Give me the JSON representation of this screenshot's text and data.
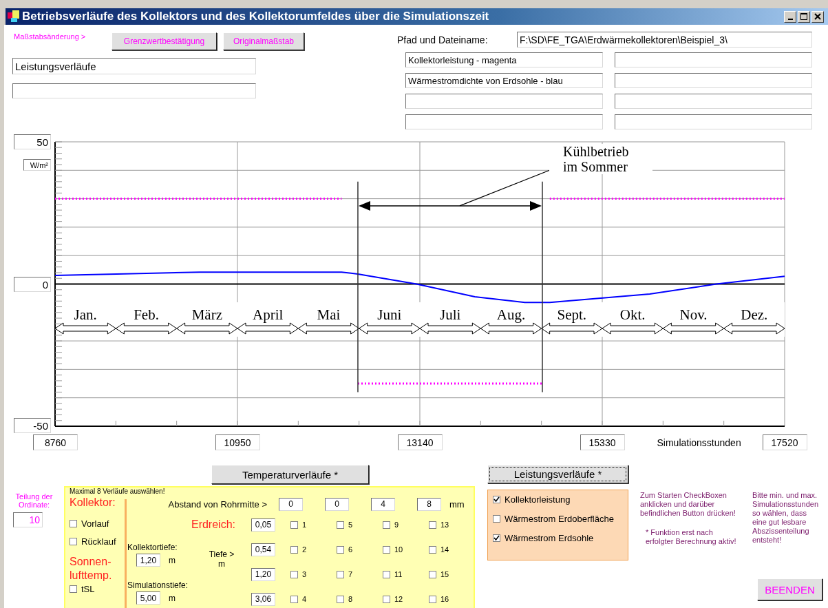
{
  "window": {
    "title": "Betriebsverläufe des Kollektors und des Kollektorumfeldes über die Simulationszeit"
  },
  "scale": {
    "label": "Maßstabsänderung >",
    "buttons": [
      "Grenzwertbestätigung",
      "Originalmaßstab"
    ]
  },
  "heading_field": {
    "value": "Leistungsverläufe"
  },
  "path": {
    "label": "Pfad und Dateiname:",
    "value": "F:\\SD\\FE_TGA\\Erdwärmekollektoren\\Beispiel_3\\"
  },
  "legend_fields": [
    "Kollektorleistung - magenta",
    "Wärmestromdichte von Erdsohle - blau"
  ],
  "y_unit": "W/m²",
  "chart_data": {
    "type": "line",
    "x": [
      8760,
      9500,
      10500,
      11500,
      12200,
      12396,
      13100,
      13800,
      14400,
      14611,
      14700,
      15900,
      16700,
      17520
    ],
    "xlim": [
      8760,
      17520
    ],
    "ylim": [
      -50,
      50
    ],
    "xticks": [
      8760,
      10950,
      13140,
      15330,
      17520
    ],
    "yticks": [
      -50,
      0,
      50
    ],
    "series": [
      {
        "color": "#ff00ff",
        "line_style": "dotted",
        "values": [
          30,
          30,
          30,
          30,
          30,
          -35,
          -35,
          -35,
          -35,
          -35,
          30,
          30,
          30,
          30
        ]
      },
      {
        "color": "#0000ff",
        "line_style": "solid",
        "values": [
          3,
          3.5,
          4.2,
          4.2,
          4.2,
          3.5,
          0,
          -4.5,
          -6.5,
          -6.5,
          -6.5,
          -3.5,
          0,
          2.7
        ]
      }
    ],
    "grid": true,
    "ref_lines": [
      {
        "axis": "x",
        "value": 12396
      },
      {
        "axis": "x",
        "value": 14611
      }
    ],
    "annotations": [
      "Kühlbetrieb im Sommer"
    ]
  },
  "months": [
    "Jan.",
    "Feb.",
    "März",
    "April",
    "Mai",
    "Juni",
    "Juli",
    "Aug.",
    "Sept.",
    "Okt.",
    "Nov.",
    "Dez."
  ],
  "x_label": "Simulationsstunden",
  "temperature_button": "Temperaturverläufe *",
  "ordinate": {
    "label": "Teilung der Ordinate:",
    "value": "10"
  },
  "temperature_panel": {
    "title": "Maximal 8 Verläufe auswählen!",
    "collector_heading": "Kollektor:",
    "collector_options": [
      {
        "label": "Vorlauf",
        "checked": false
      },
      {
        "label": "Rücklauf",
        "checked": false
      }
    ],
    "sun_heading": "Sonnen-lufttemp.",
    "sun_options": [
      {
        "label": "tSL",
        "checked": false
      }
    ],
    "distance_label": "Abstand von Rohrmitte >",
    "distances": [
      "0",
      "0",
      "4",
      "8"
    ],
    "distance_unit": "mm",
    "soil_heading": "Erdreich:",
    "depth_label": "Tiefe >",
    "depth_unit": "m",
    "depths": [
      {
        "value": "0,05",
        "sensors": [
          {
            "label": "1",
            "checked": false
          },
          {
            "label": "5",
            "checked": false
          },
          {
            "label": "9",
            "checked": false
          },
          {
            "label": "13",
            "checked": false
          }
        ]
      },
      {
        "value": "0,54",
        "sensors": [
          {
            "label": "2",
            "checked": false
          },
          {
            "label": "6",
            "checked": false
          },
          {
            "label": "10",
            "checked": false
          },
          {
            "label": "14",
            "checked": false
          }
        ]
      },
      {
        "value": "1,20",
        "sensors": [
          {
            "label": "3",
            "checked": false
          },
          {
            "label": "7",
            "checked": false
          },
          {
            "label": "11",
            "checked": false
          },
          {
            "label": "15",
            "checked": false
          }
        ]
      },
      {
        "value": "3,06",
        "sensors": [
          {
            "label": "4",
            "checked": false
          },
          {
            "label": "8",
            "checked": false
          },
          {
            "label": "12",
            "checked": false
          },
          {
            "label": "16",
            "checked": false
          }
        ]
      }
    ],
    "collector_depth": {
      "label": "Kollektortiefe:",
      "value": "1,20",
      "unit": "m"
    },
    "simulation_depth": {
      "label": "Simulationstiefe:",
      "value": "5,00",
      "unit": "m"
    }
  },
  "power_button": "Leistungsverläufe *",
  "power_options": [
    {
      "label": "Kollektorleistung",
      "checked": true
    },
    {
      "label": "Wärmestrom Erdoberfläche",
      "checked": false
    },
    {
      "label": "Wärmestrom Erdsohle",
      "checked": true
    }
  ],
  "notes": [
    "Zum Starten CheckBoxen anklicken und darüber befindlichen Button drücken!",
    "* Funktion erst nach erfolgter Berechnung aktiv!"
  ],
  "hint": "Bitte min. und max. Simulationsstunden so wählen, dass eine gut lesbare Abszissenteilung entsteht!",
  "exit_button": "BEENDEN"
}
